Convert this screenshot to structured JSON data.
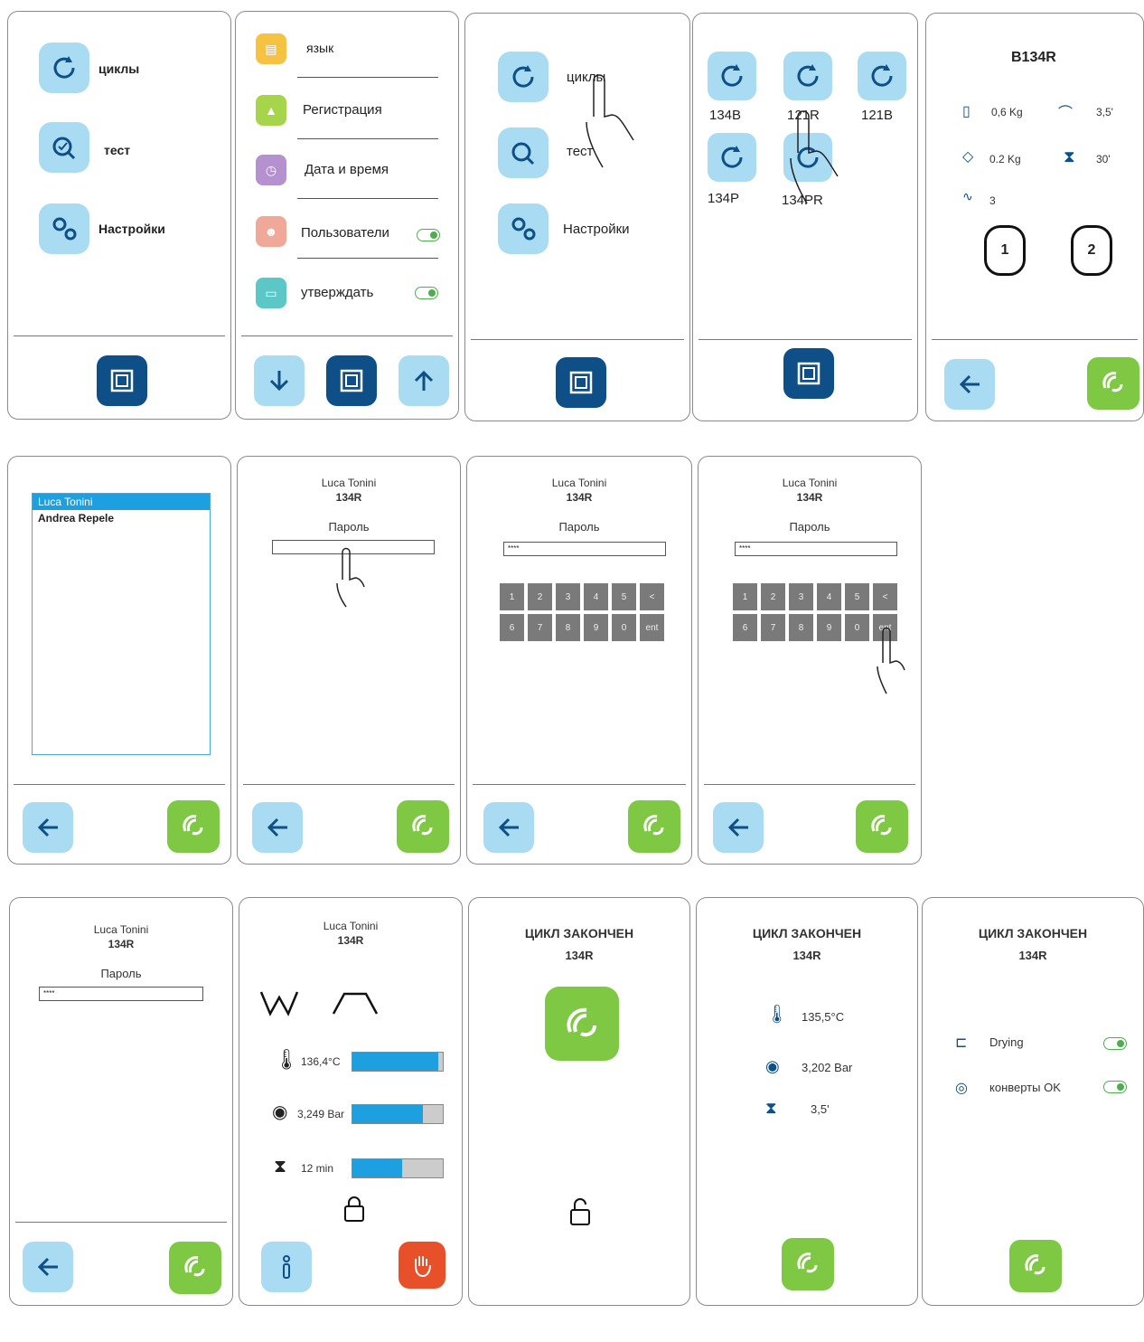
{
  "p1": {
    "items": [
      {
        "label": "циклы"
      },
      {
        "label": "тест"
      },
      {
        "label": "Настройки"
      }
    ]
  },
  "p2": {
    "items": [
      {
        "label": "язык"
      },
      {
        "label": "Регистрация"
      },
      {
        "label": "Дата и время"
      },
      {
        "label": "Пользователи"
      },
      {
        "label": "утверждать"
      }
    ]
  },
  "p3": {
    "items": [
      {
        "label": "циклы"
      },
      {
        "label": "тест"
      },
      {
        "label": "Настройки"
      }
    ]
  },
  "p4": {
    "cycles": [
      {
        "label": "134B"
      },
      {
        "label": "121R"
      },
      {
        "label": "121B"
      },
      {
        "label": "134P"
      },
      {
        "label": "134PR"
      }
    ]
  },
  "p5": {
    "title": "B134R",
    "stats": {
      "load1": "0,6 Kg",
      "temp_time": "3,5'",
      "load2": "0.2 Kg",
      "dry_time": "30'",
      "pulses": "3"
    },
    "badge1": "1",
    "badge2": "2"
  },
  "p6": {
    "users": [
      "Luca Tonini",
      "Andrea Repele"
    ]
  },
  "login": {
    "user": "Luca Tonini",
    "cycle": "134R",
    "password_label": "Пароль",
    "password_mask": "****"
  },
  "keypad": {
    "keys": [
      "1",
      "2",
      "3",
      "4",
      "5",
      "<",
      "6",
      "7",
      "8",
      "9",
      "0",
      "ent"
    ]
  },
  "p12": {
    "user": "Luca Tonini",
    "cycle": "134R",
    "temp": "136,4°C",
    "pressure": "3,249 Bar",
    "time": "12 min",
    "temp_progress": 0.95,
    "pressure_progress": 0.78,
    "time_progress": 0.55
  },
  "done": {
    "title": "ЦИКЛ ЗАКОНЧЕН",
    "cycle": "134R"
  },
  "p14": {
    "temp": "135,5°C",
    "pressure": "3,202 Bar",
    "time": "3,5'"
  },
  "p15": {
    "drying": "Drying",
    "envelopes": "конверты OK"
  },
  "colors": {
    "accent_light": "#a9dbf2",
    "accent_dark": "#0d4f86",
    "green": "#7ec843",
    "stop_red": "#e8502a",
    "progress": "#1ea0e0"
  }
}
